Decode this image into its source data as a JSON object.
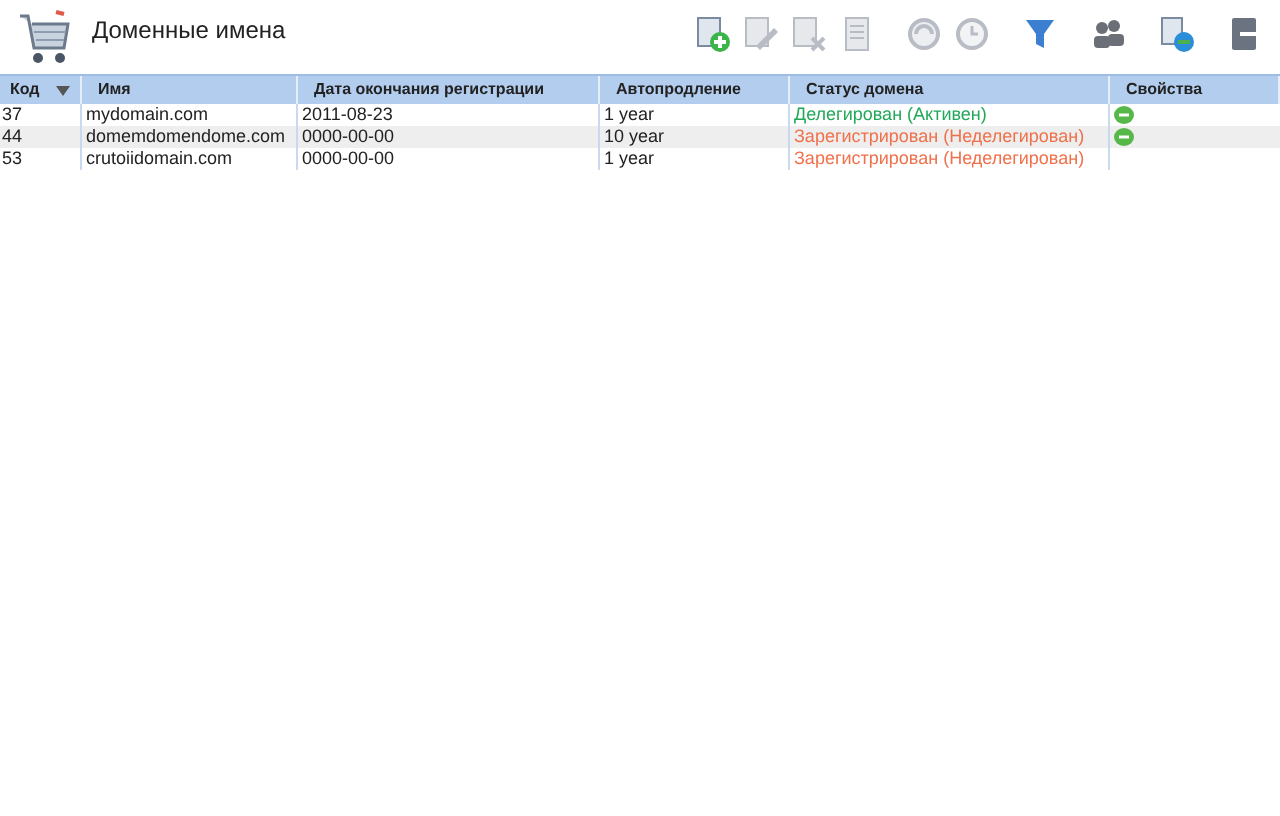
{
  "page": {
    "title": "Доменные имена"
  },
  "toolbar": [
    {
      "kind": "add",
      "disabled": false
    },
    {
      "kind": "edit",
      "disabled": true
    },
    {
      "kind": "delete",
      "disabled": true
    },
    {
      "kind": "document",
      "disabled": true
    },
    {
      "kind": "renew",
      "disabled": true
    },
    {
      "kind": "clock",
      "disabled": true
    },
    {
      "kind": "filter",
      "disabled": false
    },
    {
      "kind": "users",
      "disabled": false
    },
    {
      "kind": "globe",
      "disabled": false
    },
    {
      "kind": "exit",
      "disabled": false
    }
  ],
  "table": {
    "columns": [
      {
        "label": "Код",
        "sorted": true
      },
      {
        "label": "Имя",
        "sorted": false
      },
      {
        "label": "Дата окончания регистрации",
        "sorted": false
      },
      {
        "label": "Автопродление",
        "sorted": false
      },
      {
        "label": "Статус домена",
        "sorted": false
      },
      {
        "label": "Свойства",
        "sorted": false
      }
    ],
    "rows": [
      {
        "id": "37",
        "name": "mydomain.com",
        "expires": "2011-08-23",
        "renewal": "1 year",
        "status": "Делегирован (Активен)",
        "color": "#22a85a",
        "properties": true
      },
      {
        "id": "44",
        "name": "domemdomendome.com",
        "expires": "0000-00-00",
        "renewal": "10 year",
        "status": "Зарегистрирован (Неделегирован)",
        "color": "#f0704a",
        "properties": true
      },
      {
        "id": "53",
        "name": "crutoiidomain.com",
        "expires": "0000-00-00",
        "renewal": "1 year",
        "status": "Зарегистрирован (Неделегирован)",
        "color": "#f0704a",
        "properties": false
      }
    ]
  }
}
